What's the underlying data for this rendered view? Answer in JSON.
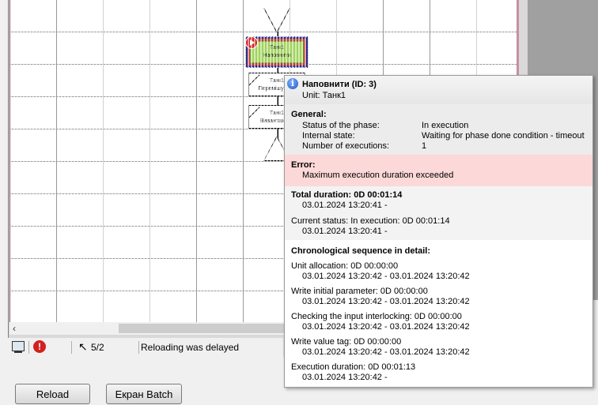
{
  "diagram": {
    "active_step": {
      "unit": "Танк1",
      "name": "Наповнити"
    },
    "steps": [
      {
        "unit": "Танк1",
        "name": "Перемішувати"
      },
      {
        "unit": "Танк1",
        "name": "Вивантажити"
      }
    ]
  },
  "status_bar": {
    "error_glyph": "!",
    "count": "5/2",
    "message": "Reloading was delayed"
  },
  "buttons": {
    "reload": "Reload",
    "batch": "Екран Batch"
  },
  "tooltip": {
    "info_glyph": "i",
    "title": "Наповнити (ID: 3)",
    "unit": "Unit: Танк1",
    "general": {
      "heading": "General:",
      "rows": [
        {
          "label": "Status of the phase:",
          "value": "In execution"
        },
        {
          "label": "Internal state:",
          "value": "Waiting for phase done condition - timeout"
        },
        {
          "label": "Number of executions:",
          "value": "1"
        }
      ]
    },
    "error": {
      "heading": "Error:",
      "message": "Maximum execution duration exceeded"
    },
    "total": {
      "heading": "Total  duration: 0D 00:01:14",
      "heading_range": "03.01.2024 13:20:41  -",
      "current": "Current status: In execution: 0D 00:01:14",
      "current_range": "03.01.2024 13:20:41  -"
    },
    "chrono": {
      "heading": "Chronological sequence in detail:",
      "items": [
        {
          "title": "Unit allocation: 0D 00:00:00",
          "range": "03.01.2024 13:20:42  -  03.01.2024 13:20:42"
        },
        {
          "title": "Write initial parameter: 0D 00:00:00",
          "range": "03.01.2024 13:20:42  -  03.01.2024 13:20:42"
        },
        {
          "title": "Checking the input interlocking: 0D 00:00:00",
          "range": "03.01.2024 13:20:42  -  03.01.2024 13:20:42"
        },
        {
          "title": "Write value tag: 0D 00:00:00",
          "range": "03.01.2024 13:20:42  -  03.01.2024 13:20:42"
        },
        {
          "title": "Execution duration: 0D 00:01:13",
          "range": "03.01.2024 13:20:42  -"
        }
      ]
    }
  }
}
